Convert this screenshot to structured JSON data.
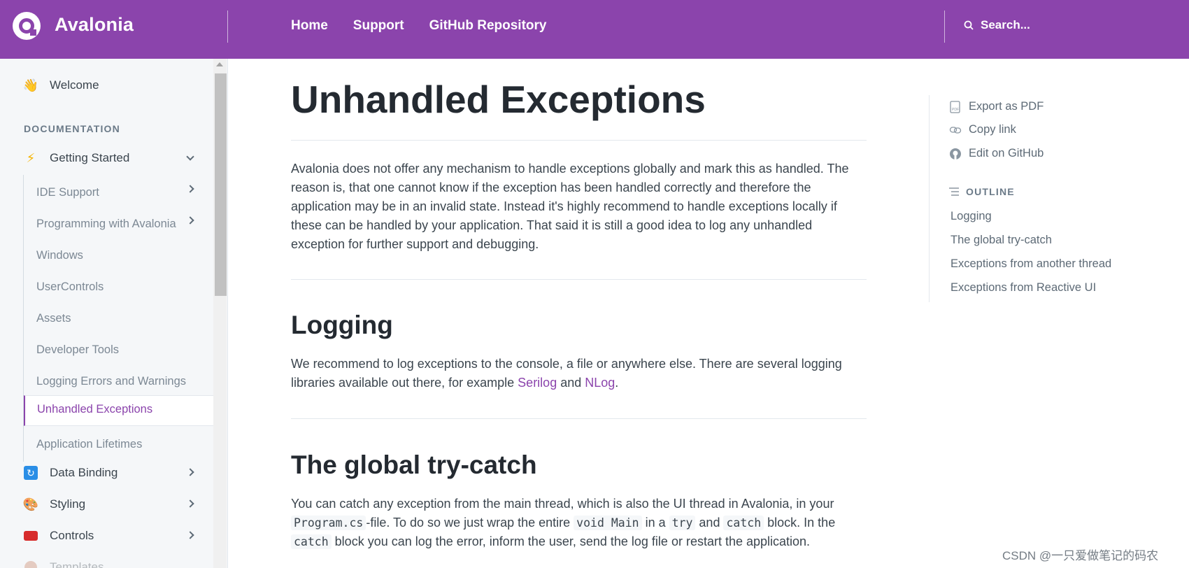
{
  "header": {
    "brand": "Avalonia",
    "nav": [
      "Home",
      "Support",
      "GitHub Repository"
    ],
    "search_placeholder": "Search...",
    "color": "#8b44ac"
  },
  "sidebar": {
    "welcome": {
      "icon": "waving-hand-icon",
      "label": "Welcome"
    },
    "section_label": "DOCUMENTATION",
    "getting_started": {
      "icon": "lightning-icon",
      "label": "Getting Started"
    },
    "sub_items": [
      {
        "label": "IDE Support",
        "has_children": true
      },
      {
        "label": "Programming with Avalonia",
        "has_children": true
      },
      {
        "label": "Windows",
        "has_children": false
      },
      {
        "label": "UserControls",
        "has_children": false
      },
      {
        "label": "Assets",
        "has_children": false
      },
      {
        "label": "Developer Tools",
        "has_children": false
      },
      {
        "label": "Logging Errors and Warnings",
        "has_children": false
      }
    ],
    "active_item": "Unhandled Exceptions",
    "after_active": "Application Lifetimes",
    "groups": [
      {
        "icon": "refresh-icon",
        "label": "Data Binding"
      },
      {
        "icon": "palette-icon",
        "label": "Styling"
      },
      {
        "icon": "toolbox-icon",
        "label": "Controls"
      },
      {
        "icon": "template-icon",
        "label": "Templates"
      }
    ]
  },
  "main": {
    "title": "Unhandled Exceptions",
    "intro": "Avalonia does not offer any mechanism to handle exceptions globally and mark this as handled. The reason is, that one cannot know if the exception has been handled correctly and therefore the application may be in an invalid state. Instead it's highly recommend to handle exceptions locally if these can be handled by your application. That said it is still a good idea to log any unhandled exception for further support and debugging.",
    "logging": {
      "heading": "Logging",
      "text_before": "We recommend to log exceptions to the console, a file or anywhere else. There are several logging libraries available out there, for example ",
      "link1": "Serilog",
      "between": " and ",
      "link2": "NLog",
      "after": "."
    },
    "global": {
      "heading": "The global try-catch",
      "t1": "You can catch any exception from the main thread, which is also the UI thread in Avalonia, in your ",
      "c1": "Program.cs",
      "t2": "-file. To do so we just wrap the entire ",
      "c2": "void Main",
      "t3": " in a ",
      "c3": "try",
      "t4": " and ",
      "c4": "catch",
      "t5": " block. In the ",
      "c5": "catch",
      "t6": " block you can log the error, inform the user, send the log file or restart the application."
    }
  },
  "toc": {
    "actions": [
      {
        "icon": "pdf-icon",
        "label": "Export as PDF"
      },
      {
        "icon": "link-icon",
        "label": "Copy link"
      },
      {
        "icon": "github-icon",
        "label": "Edit on GitHub"
      }
    ],
    "outline_label": "OUTLINE",
    "links": [
      "Logging",
      "The global try-catch",
      "Exceptions from another thread",
      "Exceptions from Reactive UI"
    ]
  },
  "watermark": "CSDN @一只爱做笔记的码农"
}
